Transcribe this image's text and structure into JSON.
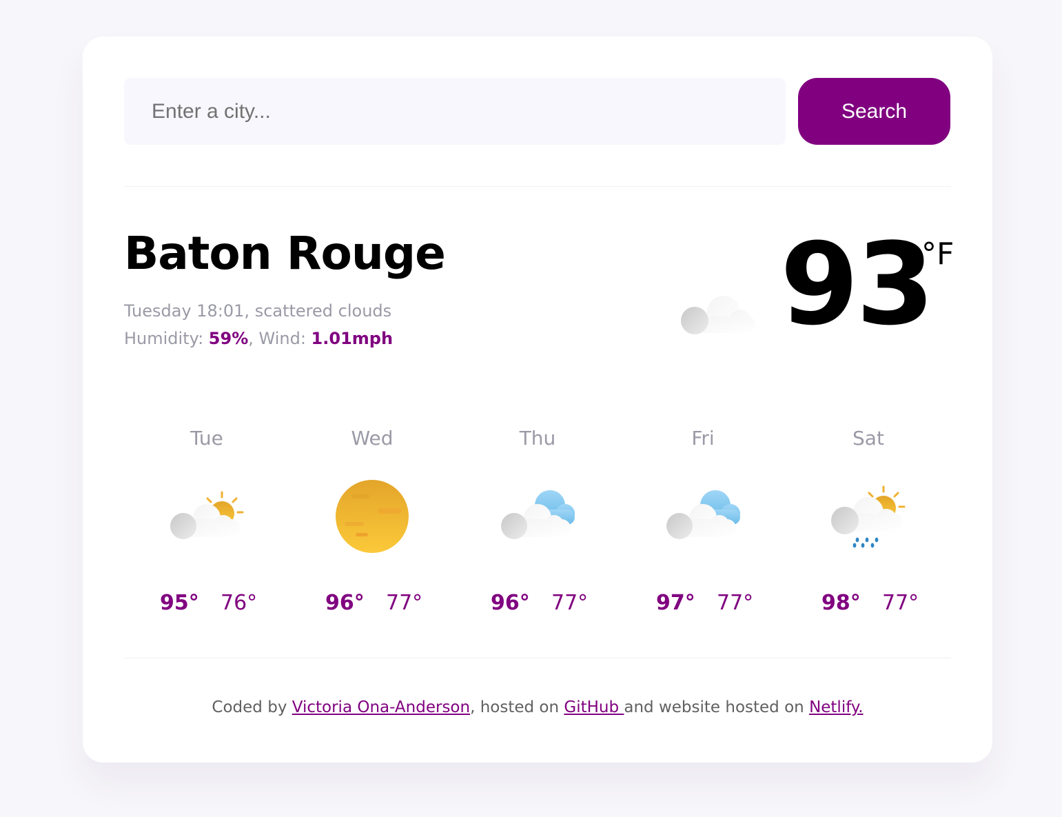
{
  "search": {
    "placeholder": "Enter a city...",
    "value": "",
    "button_label": "Search"
  },
  "current": {
    "city": "Baton Rouge",
    "description": "Tuesday 18:01, scattered clouds",
    "humidity_label": "Humidity: ",
    "humidity": "59%",
    "wind_label": ", Wind: ",
    "wind": "1.01mph",
    "temperature": "93",
    "unit": "°F",
    "icon": "scattered-clouds-icon"
  },
  "forecast": [
    {
      "day": "Tue",
      "max": "95°",
      "min": "76°",
      "icon": "partly-cloudy-icon"
    },
    {
      "day": "Wed",
      "max": "96°",
      "min": "77°",
      "icon": "sun-icon"
    },
    {
      "day": "Thu",
      "max": "96°",
      "min": "77°",
      "icon": "clouds-icon"
    },
    {
      "day": "Fri",
      "max": "97°",
      "min": "77°",
      "icon": "clouds-icon"
    },
    {
      "day": "Sat",
      "max": "98°",
      "min": "77°",
      "icon": "rain-sun-icon"
    }
  ],
  "footer": {
    "prefix": "Coded by ",
    "author": "Victoria Ona-Anderson",
    "middle1": ", hosted on ",
    "github": "GitHub ",
    "middle2": "and website hosted on ",
    "netlify": "Netlify."
  },
  "colors": {
    "accent": "#800080",
    "muted_text": "#9a9aa6",
    "input_bg": "#f7f7fd",
    "page_bg": "#f7f6fa"
  }
}
